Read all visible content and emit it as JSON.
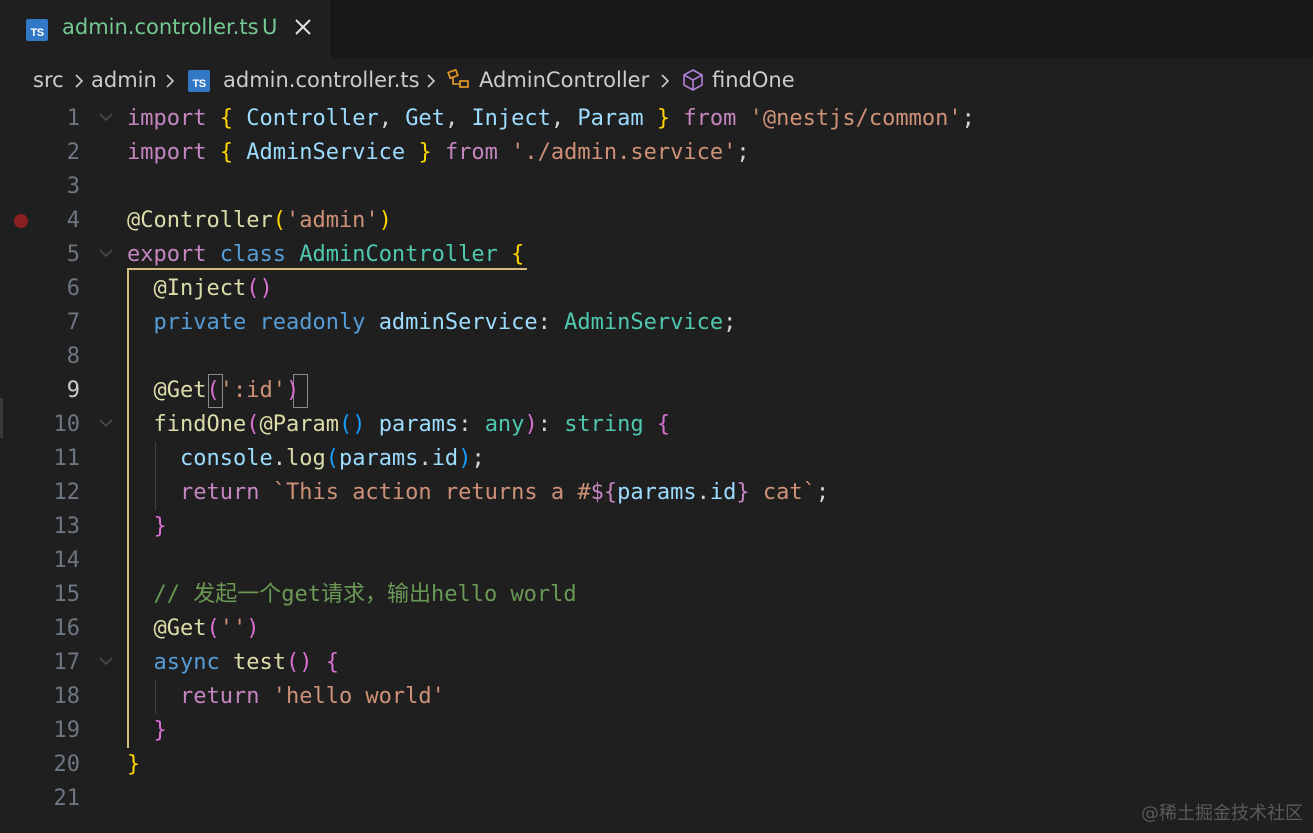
{
  "tab": {
    "icon": "typescript-file-icon",
    "title": "admin.controller.ts",
    "badge": "U",
    "close_icon": "close-icon"
  },
  "breadcrumb": {
    "items": [
      {
        "label": "src"
      },
      {
        "label": "admin"
      },
      {
        "label": "admin.controller.ts",
        "icon": "typescript-file-icon"
      },
      {
        "label": "AdminController",
        "icon": "class-icon"
      },
      {
        "label": "findOne",
        "icon": "method-cube-icon"
      }
    ]
  },
  "editor": {
    "active_line": 9,
    "breakpoint_line": 4,
    "fold_lines": [
      1,
      5,
      10,
      17
    ],
    "colors": {
      "background": "#1f1f1f",
      "keyword": "#c586c0",
      "storage": "#569cd6",
      "class_name": "#4ec9b0",
      "function": "#dcdcaa",
      "variable": "#9cdcfe",
      "string": "#ce9178",
      "comment": "#6a9955",
      "bracket_gold": "#ffd700",
      "bracket_purple": "#da70d6",
      "bracket_blue": "#179fff",
      "line_number": "#6e7681",
      "breakpoint": "#8a1f1f",
      "untracked": "#73c991"
    },
    "lines": [
      {
        "n": "1",
        "tokens": [
          [
            "import",
            "k"
          ],
          [
            " ",
            ""
          ],
          [
            "{",
            "b1"
          ],
          [
            " ",
            ""
          ],
          [
            "Controller",
            "c"
          ],
          [
            ", ",
            ""
          ],
          [
            "Get",
            "c"
          ],
          [
            ", ",
            ""
          ],
          [
            "Inject",
            "c"
          ],
          [
            ", ",
            ""
          ],
          [
            "Param",
            "c"
          ],
          [
            " ",
            ""
          ],
          [
            "}",
            "b1"
          ],
          [
            " ",
            ""
          ],
          [
            "from",
            "k"
          ],
          [
            " ",
            ""
          ],
          [
            "'@nestjs/common'",
            "s"
          ],
          [
            ";",
            ""
          ]
        ]
      },
      {
        "n": "2",
        "tokens": [
          [
            "import",
            "k"
          ],
          [
            " ",
            ""
          ],
          [
            "{",
            "b1"
          ],
          [
            " ",
            ""
          ],
          [
            "AdminService",
            "c"
          ],
          [
            " ",
            ""
          ],
          [
            "}",
            "b1"
          ],
          [
            " ",
            ""
          ],
          [
            "from",
            "k"
          ],
          [
            " ",
            ""
          ],
          [
            "'./admin.service'",
            "s"
          ],
          [
            ";",
            ""
          ]
        ]
      },
      {
        "n": "3",
        "tokens": []
      },
      {
        "n": "4",
        "tokens": [
          [
            "@",
            "f"
          ],
          [
            "Controller",
            "f"
          ],
          [
            "(",
            "b1"
          ],
          [
            "'admin'",
            "s"
          ],
          [
            ")",
            "b1"
          ]
        ]
      },
      {
        "n": "5",
        "tokens": [
          [
            "export",
            "k"
          ],
          [
            " ",
            ""
          ],
          [
            "class",
            "st"
          ],
          [
            " ",
            ""
          ],
          [
            "AdminController",
            "t"
          ],
          [
            " ",
            ""
          ],
          [
            "{",
            "b1"
          ]
        ]
      },
      {
        "n": "6",
        "tokens": [
          [
            "  ",
            ""
          ],
          [
            "@",
            "f"
          ],
          [
            "Inject",
            "f"
          ],
          [
            "(",
            "b2"
          ],
          [
            ")",
            "b2"
          ]
        ]
      },
      {
        "n": "7",
        "tokens": [
          [
            "  ",
            ""
          ],
          [
            "private",
            "st"
          ],
          [
            " ",
            ""
          ],
          [
            "readonly",
            "st"
          ],
          [
            " ",
            ""
          ],
          [
            "adminService",
            "v"
          ],
          [
            ": ",
            ""
          ],
          [
            "AdminService",
            "t"
          ],
          [
            ";",
            ""
          ]
        ]
      },
      {
        "n": "8",
        "tokens": []
      },
      {
        "n": "9",
        "tokens": [
          [
            "  ",
            ""
          ],
          [
            "@",
            "f"
          ],
          [
            "Get",
            "f"
          ],
          [
            "(",
            "b2"
          ],
          [
            "':id'",
            "s"
          ],
          [
            ")",
            "b2"
          ]
        ]
      },
      {
        "n": "10",
        "tokens": [
          [
            "  ",
            ""
          ],
          [
            "findOne",
            "f"
          ],
          [
            "(",
            "b2"
          ],
          [
            "@",
            "f"
          ],
          [
            "Param",
            "f"
          ],
          [
            "(",
            "b3"
          ],
          [
            ")",
            "b3"
          ],
          [
            " ",
            ""
          ],
          [
            "params",
            "v"
          ],
          [
            ": ",
            ""
          ],
          [
            "any",
            "t"
          ],
          [
            ")",
            "b2"
          ],
          [
            ": ",
            ""
          ],
          [
            "string",
            "t"
          ],
          [
            " ",
            ""
          ],
          [
            "{",
            "b2"
          ]
        ]
      },
      {
        "n": "11",
        "tokens": [
          [
            "    ",
            ""
          ],
          [
            "console",
            "v"
          ],
          [
            ".",
            ""
          ],
          [
            "log",
            "f"
          ],
          [
            "(",
            "b3"
          ],
          [
            "params",
            "v"
          ],
          [
            ".",
            ""
          ],
          [
            "id",
            "v"
          ],
          [
            ")",
            "b3"
          ],
          [
            ";",
            ""
          ]
        ]
      },
      {
        "n": "12",
        "tokens": [
          [
            "    ",
            ""
          ],
          [
            "return",
            "k"
          ],
          [
            " ",
            ""
          ],
          [
            "`This action returns a #",
            "s"
          ],
          [
            "${",
            "k"
          ],
          [
            "params",
            "v"
          ],
          [
            ".",
            ""
          ],
          [
            "id",
            "v"
          ],
          [
            "}",
            "k"
          ],
          [
            " cat`",
            "s"
          ],
          [
            ";",
            ""
          ]
        ]
      },
      {
        "n": "13",
        "tokens": [
          [
            "  ",
            ""
          ],
          [
            "}",
            "b2"
          ]
        ]
      },
      {
        "n": "14",
        "tokens": []
      },
      {
        "n": "15",
        "tokens": [
          [
            "  ",
            ""
          ],
          [
            "// 发起一个get请求，输出hello world",
            "cm"
          ]
        ]
      },
      {
        "n": "16",
        "tokens": [
          [
            "  ",
            ""
          ],
          [
            "@",
            "f"
          ],
          [
            "Get",
            "f"
          ],
          [
            "(",
            "b2"
          ],
          [
            "''",
            "s"
          ],
          [
            ")",
            "b2"
          ]
        ]
      },
      {
        "n": "17",
        "tokens": [
          [
            "  ",
            ""
          ],
          [
            "async",
            "st"
          ],
          [
            " ",
            ""
          ],
          [
            "test",
            "f"
          ],
          [
            "(",
            "b2"
          ],
          [
            ")",
            "b2"
          ],
          [
            " ",
            ""
          ],
          [
            "{",
            "b2"
          ]
        ]
      },
      {
        "n": "18",
        "tokens": [
          [
            "    ",
            ""
          ],
          [
            "return",
            "k"
          ],
          [
            " ",
            ""
          ],
          [
            "'hello world'",
            "s"
          ]
        ]
      },
      {
        "n": "19",
        "tokens": [
          [
            "  ",
            ""
          ],
          [
            "}",
            "b2"
          ]
        ]
      },
      {
        "n": "20",
        "tokens": [
          [
            "}",
            "b1"
          ]
        ]
      },
      {
        "n": "21",
        "tokens": []
      }
    ]
  },
  "watermark": "@稀土掘金技术社区"
}
